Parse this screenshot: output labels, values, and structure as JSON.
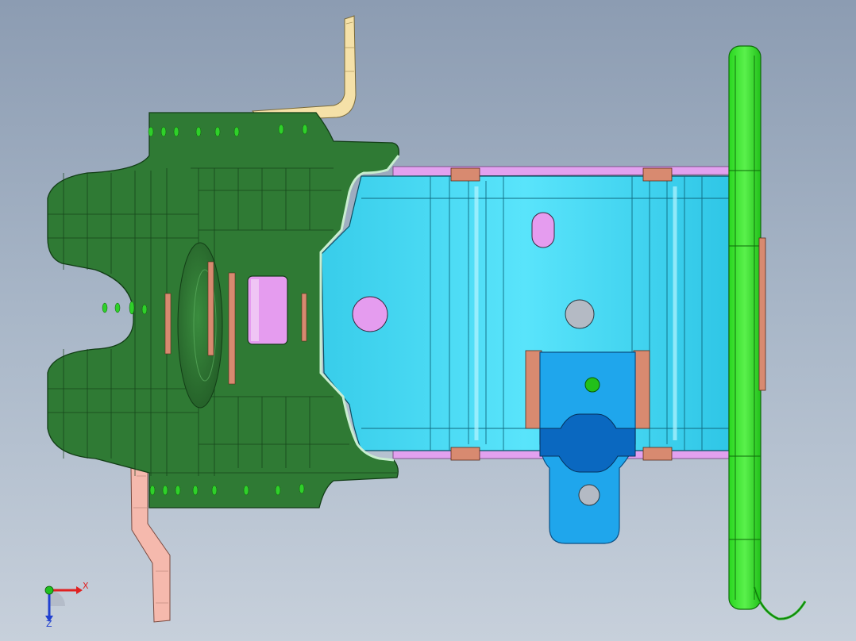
{
  "viewport": {
    "background_top": "#8c9cb2",
    "background_bottom": "#c7d0db"
  },
  "parts": {
    "bracket_body": {
      "color": "#2f7a34",
      "edge": "#123d16"
    },
    "channel": {
      "color": "#3fd8f5",
      "edge": "#0b4f63"
    },
    "flange_strip": {
      "color": "#e2a1ef"
    },
    "end_plate": {
      "color": "#33e627",
      "edge": "#0e6a0a"
    },
    "lower_tab": {
      "color": "#1fa6ec",
      "edge": "#0a4f84"
    },
    "upper_hook": {
      "color": "#f5e1a8",
      "edge": "#7a6a3a"
    },
    "lower_hook": {
      "color": "#f5b9ad",
      "edge": "#7a4a40"
    },
    "clip_color": "#d88a70",
    "hole_color": "#e59cef",
    "weld_point_color": "#2fd02a"
  },
  "triad": {
    "x_label": "X",
    "z_label": "Z",
    "x_color": "#e02020",
    "z_color": "#2040d0",
    "origin_color": "#20c020"
  }
}
